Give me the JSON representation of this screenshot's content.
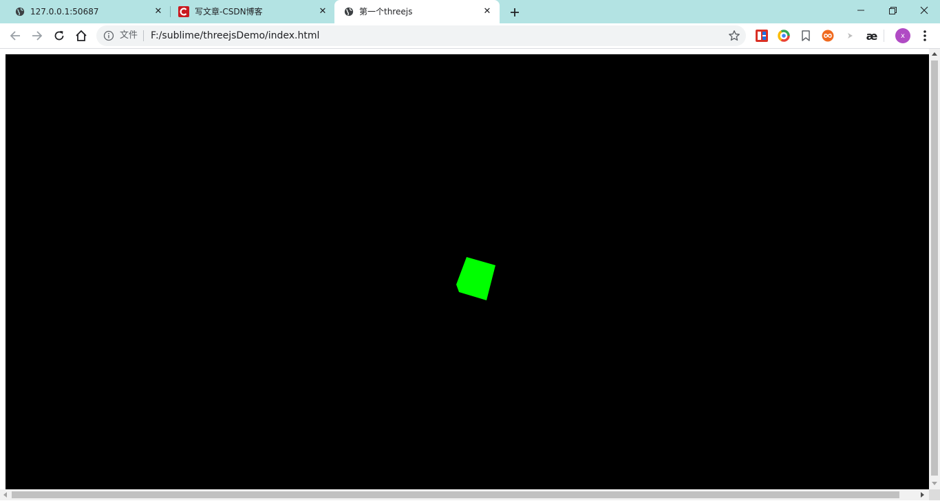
{
  "tabs": [
    {
      "title": "127.0.0.1:50687",
      "favicon": "globe-icon",
      "active": false
    },
    {
      "title": "写文章-CSDN博客",
      "favicon": "csdn-icon",
      "active": false
    },
    {
      "title": "第一个threejs",
      "favicon": "globe-icon",
      "active": true
    }
  ],
  "toolbar": {
    "omnibox_label": "文件",
    "url": "F:/sublime/threejsDemo/index.html"
  },
  "extensions": [
    {
      "name": "fe-helper-icon"
    },
    {
      "name": "chrome-ring-icon"
    },
    {
      "name": "bookmark-icon"
    },
    {
      "name": "infinity-icon"
    },
    {
      "name": "arrow-icon"
    },
    {
      "name": "ae-icon",
      "text": "æ"
    }
  ],
  "profile": {
    "initial": "x"
  },
  "colors": {
    "tabstrip": "#b3e3e3",
    "canvas_background": "#000000",
    "cube": "#00ff00",
    "avatar": "#b04bc4",
    "csdn_red": "#c91a20"
  }
}
